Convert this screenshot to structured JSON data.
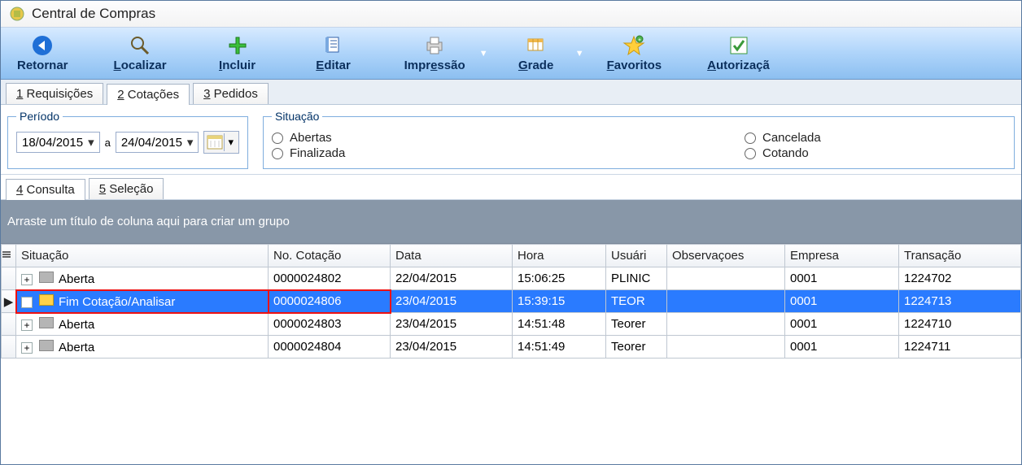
{
  "window": {
    "title": "Central de Compras"
  },
  "toolbar": {
    "retornar": "Retornar",
    "localizar": "Localizar",
    "incluir": "Incluir",
    "editar": "Editar",
    "impressao": "Impressão",
    "grade": "Grade",
    "favoritos": "Favoritos",
    "autorizacao": "Autorizaçã"
  },
  "mainTabs": {
    "requisicoes": "1 Requisições",
    "cotacoes": "2 Cotações",
    "pedidos": "3 Pedidos"
  },
  "period": {
    "legend": "Período",
    "from": "18/04/2015",
    "sep": "a",
    "to": "24/04/2015"
  },
  "situacao": {
    "legend": "Situação",
    "abertas": "Abertas",
    "finalizada": "Finalizada",
    "cancelada": "Cancelada",
    "cotando": "Cotando"
  },
  "subTabs": {
    "consulta": "4 Consulta",
    "selecao": "5 Seleção"
  },
  "groupHint": "Arraste um título de coluna aqui para criar um grupo",
  "columns": {
    "situacao": "Situação",
    "no": "No. Cotação",
    "data": "Data",
    "hora": "Hora",
    "usuario": "Usuári",
    "obs": "Observaçoes",
    "empresa": "Empresa",
    "transacao": "Transação"
  },
  "rows": [
    {
      "situacao": "Aberta",
      "no": "0000024802",
      "data": "22/04/2015",
      "hora": "15:06:25",
      "usuario": "PLINIC",
      "obs": "",
      "empresa": "0001",
      "transacao": "1224702",
      "selected": false,
      "folder": "gray"
    },
    {
      "situacao": "Fim Cotação/Analisar",
      "no": "0000024806",
      "data": "23/04/2015",
      "hora": "15:39:15",
      "usuario": "TEOR",
      "obs": "",
      "empresa": "0001",
      "transacao": "1224713",
      "selected": true,
      "folder": "yellow"
    },
    {
      "situacao": "Aberta",
      "no": "0000024803",
      "data": "23/04/2015",
      "hora": "14:51:48",
      "usuario": "Teorer",
      "obs": "",
      "empresa": "0001",
      "transacao": "1224710",
      "selected": false,
      "folder": "gray"
    },
    {
      "situacao": "Aberta",
      "no": "0000024804",
      "data": "23/04/2015",
      "hora": "14:51:49",
      "usuario": "Teorer",
      "obs": "",
      "empresa": "0001",
      "transacao": "1224711",
      "selected": false,
      "folder": "gray"
    }
  ]
}
